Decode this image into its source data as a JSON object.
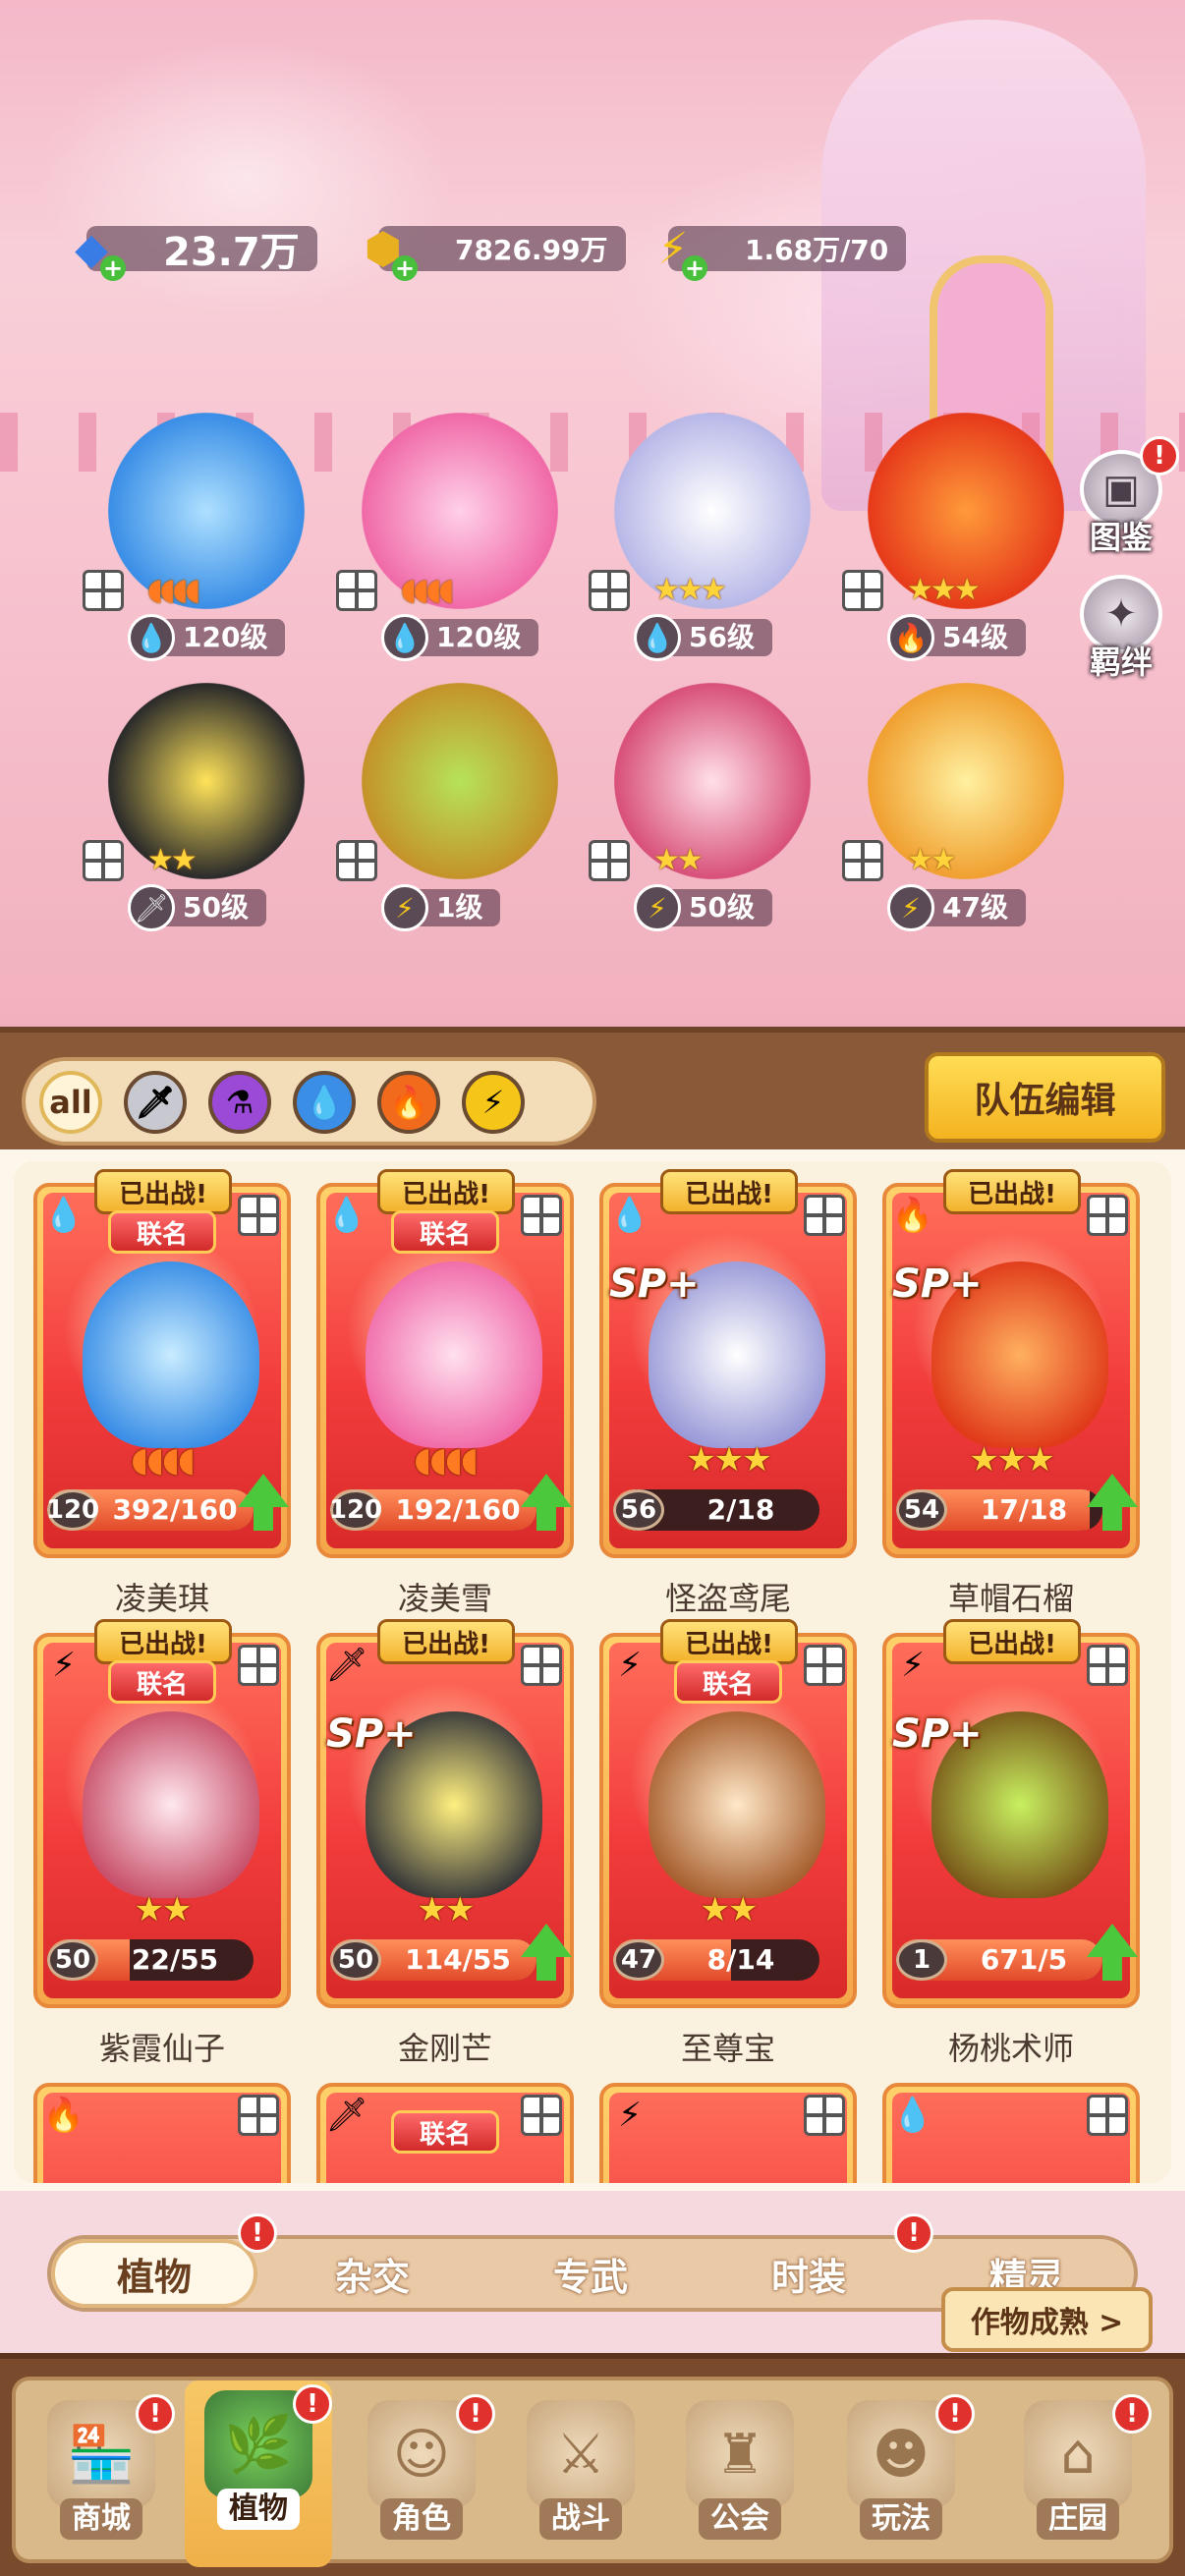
{
  "currency": {
    "gems": "23.7万",
    "gold": "7826.99万",
    "energy": "1.68万/70"
  },
  "side_buttons": {
    "codex": "图鉴",
    "bonds": "羁绊",
    "alert": "!"
  },
  "team": [
    {
      "element": "water",
      "stars": "4-orange",
      "level": "120级"
    },
    {
      "element": "water",
      "stars": "4-orange",
      "level": "120级"
    },
    {
      "element": "water",
      "stars": "★★★",
      "level": "56级"
    },
    {
      "element": "fire",
      "stars": "★★★",
      "level": "54级"
    },
    {
      "element": "metal",
      "stars": "★★",
      "level": "50级"
    },
    {
      "element": "thunder",
      "stars": "",
      "level": "1级"
    },
    {
      "element": "thunder",
      "stars": "★★",
      "level": "50级"
    },
    {
      "element": "thunder",
      "stars": "★★",
      "level": "47级"
    }
  ],
  "filters": {
    "all": "all",
    "team_edit": "队伍编辑"
  },
  "labels": {
    "deployed": "已出战!",
    "link_name": "联名",
    "sp": "SP+"
  },
  "cards": [
    {
      "name": "凌美琪",
      "level": "120",
      "progress": "392/160",
      "fill": 1.0,
      "upgrade": true,
      "element": "water",
      "link": true,
      "sp": false,
      "stars": "",
      "orange_stars": 4
    },
    {
      "name": "凌美雪",
      "level": "120",
      "progress": "192/160",
      "fill": 1.0,
      "upgrade": true,
      "element": "water",
      "link": true,
      "sp": false,
      "stars": "",
      "orange_stars": 4
    },
    {
      "name": "怪盗鸢尾",
      "level": "56",
      "progress": "2/18",
      "fill": 0.11,
      "upgrade": false,
      "element": "water",
      "link": false,
      "sp": true,
      "stars": "★★★",
      "orange_stars": 0
    },
    {
      "name": "草帽石榴",
      "level": "54",
      "progress": "17/18",
      "fill": 0.94,
      "upgrade": true,
      "element": "fire",
      "link": false,
      "sp": true,
      "stars": "★★★",
      "orange_stars": 0
    },
    {
      "name": "紫霞仙子",
      "level": "50",
      "progress": "22/55",
      "fill": 0.4,
      "upgrade": false,
      "element": "thunder",
      "link": true,
      "sp": false,
      "stars": "★★",
      "orange_stars": 0
    },
    {
      "name": "金刚芒",
      "level": "50",
      "progress": "114/55",
      "fill": 1.0,
      "upgrade": true,
      "element": "metal",
      "link": false,
      "sp": true,
      "stars": "★★",
      "orange_stars": 0
    },
    {
      "name": "至尊宝",
      "level": "47",
      "progress": "8/14",
      "fill": 0.57,
      "upgrade": false,
      "element": "thunder",
      "link": true,
      "sp": false,
      "stars": "★★",
      "orange_stars": 0
    },
    {
      "name": "杨桃术师",
      "level": "1",
      "progress": "671/5",
      "fill": 1.0,
      "upgrade": true,
      "element": "thunder",
      "link": false,
      "sp": true,
      "stars": "",
      "orange_stars": 0
    }
  ],
  "category_tabs": [
    "植物",
    "杂交",
    "专武",
    "时装",
    "精灵"
  ],
  "harvest_button": "作物成熟 >",
  "bottom_nav": [
    "商城",
    "植物",
    "角色",
    "战斗",
    "公会",
    "玩法",
    "庄园"
  ],
  "colors": {
    "water": "#3a8ee6",
    "fire": "#f26a1c",
    "thunder": "#f5c518",
    "metal": "#b8b8c0",
    "poison": "#9a4ad6",
    "alert": "#e0312c",
    "upgrade": "#4cc83c"
  }
}
